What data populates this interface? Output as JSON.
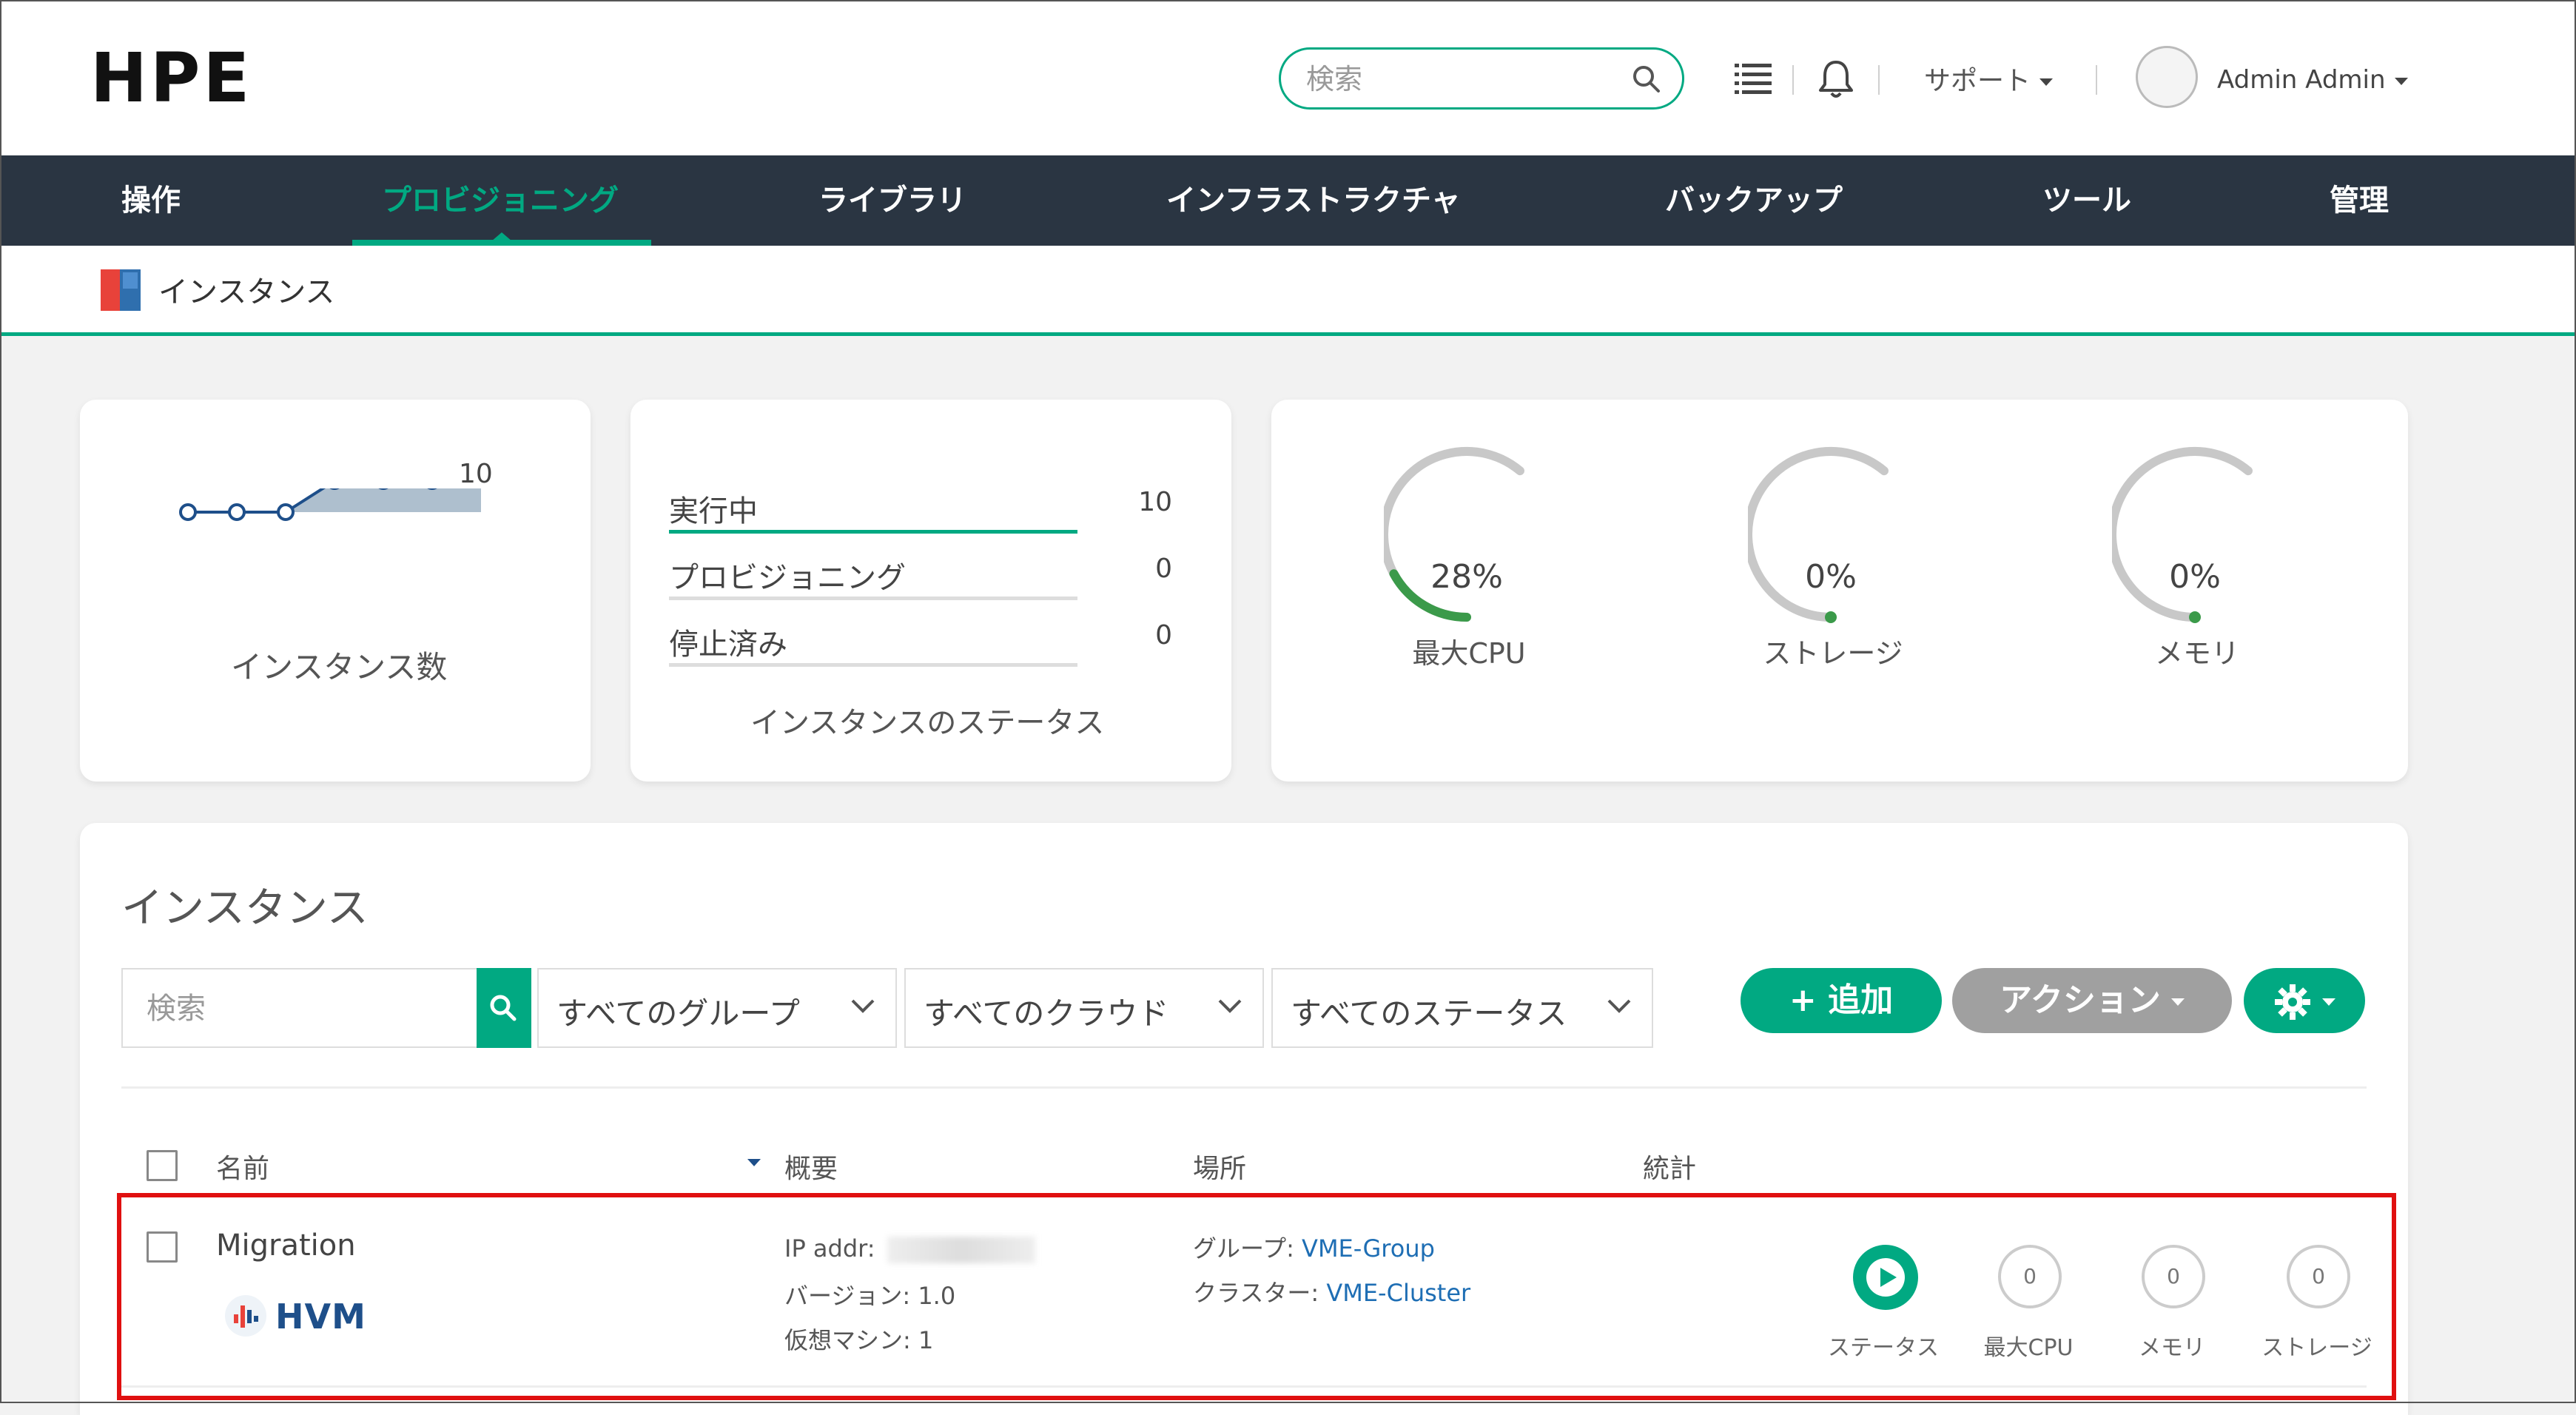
{
  "header": {
    "logo": "HPE",
    "search_placeholder": "検索",
    "support_label": "サポート",
    "user_label": "Admin Admin",
    "icons": [
      "search-icon",
      "list-icon",
      "bell-icon",
      "avatar"
    ]
  },
  "nav": {
    "items": [
      "操作",
      "プロビジョニング",
      "ライブラリ",
      "インフラストラクチャ",
      "バックアップ",
      "ツール",
      "管理"
    ],
    "active": "プロビジョニング"
  },
  "breadcrumb": {
    "title": "インスタンス"
  },
  "cards": {
    "instance_count": {
      "max_label": "10",
      "caption": "インスタンス数",
      "series": [
        0,
        0,
        0,
        3,
        3,
        3,
        6
      ]
    },
    "status": {
      "rows": [
        {
          "label": "実行中",
          "count": "10"
        },
        {
          "label": "プロビジョニング",
          "count": "0"
        },
        {
          "label": "停止済み",
          "count": "0"
        }
      ],
      "caption": "インスタンスのステータス"
    },
    "gauges": [
      {
        "value": "28%",
        "label": "最大CPU",
        "fraction": 0.28
      },
      {
        "value": "0%",
        "label": "ストレージ",
        "fraction": 0
      },
      {
        "value": "0%",
        "label": "メモリ",
        "fraction": 0
      }
    ]
  },
  "instances": {
    "title": "インスタンス",
    "search_placeholder": "検索",
    "filters": [
      "すべてのグループ",
      "すべてのクラウド",
      "すべてのステータス"
    ],
    "add_label": "+ 追加",
    "action_label": "アクション",
    "columns": [
      "名前",
      "概要",
      "場所",
      "統計"
    ],
    "row": {
      "name": "Migration",
      "type": "HVM",
      "ip_label": "IP addr: ",
      "version": "バージョン: 1.0",
      "vms": "仮想マシン: 1",
      "group_label": "グループ: ",
      "group": "VME-Group",
      "cluster_label": "クラスター: ",
      "cluster": "VME-Cluster",
      "stats": [
        {
          "label": "ステータス"
        },
        {
          "label": "最大CPU",
          "value": "0"
        },
        {
          "label": "メモリ",
          "value": "0"
        },
        {
          "label": "ストレージ",
          "value": "0"
        }
      ]
    }
  },
  "colors": {
    "accent": "#01a982",
    "nav_bg": "#2a3542",
    "highlight": "#e01010"
  }
}
